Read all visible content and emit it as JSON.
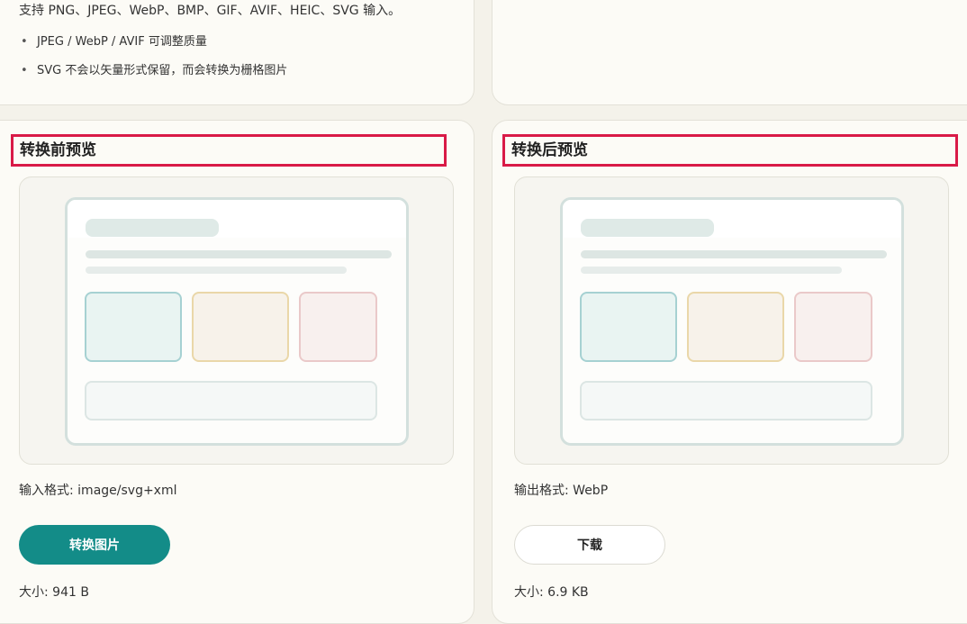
{
  "support": {
    "formats_text": "支持 PNG、JPEG、WebP、BMP、GIF、AVIF、HEIC、SVG 输入。",
    "notes": [
      "JPEG / WebP / AVIF 可调整质量",
      "SVG 不会以矢量形式保留，而会转换为栅格图片"
    ]
  },
  "before": {
    "title": "转换前预览",
    "format_text": "输入格式: image/svg+xml",
    "button_label": "转换图片",
    "size_text": "大小: 941 B"
  },
  "after": {
    "title": "转换后预览",
    "format_text": "输出格式: WebP",
    "button_label": "下载",
    "size_text": "大小: 6.9 KB"
  },
  "colors": {
    "accent": "#138c88",
    "highlight": "#d91a47",
    "background": "#f4f2ea"
  }
}
